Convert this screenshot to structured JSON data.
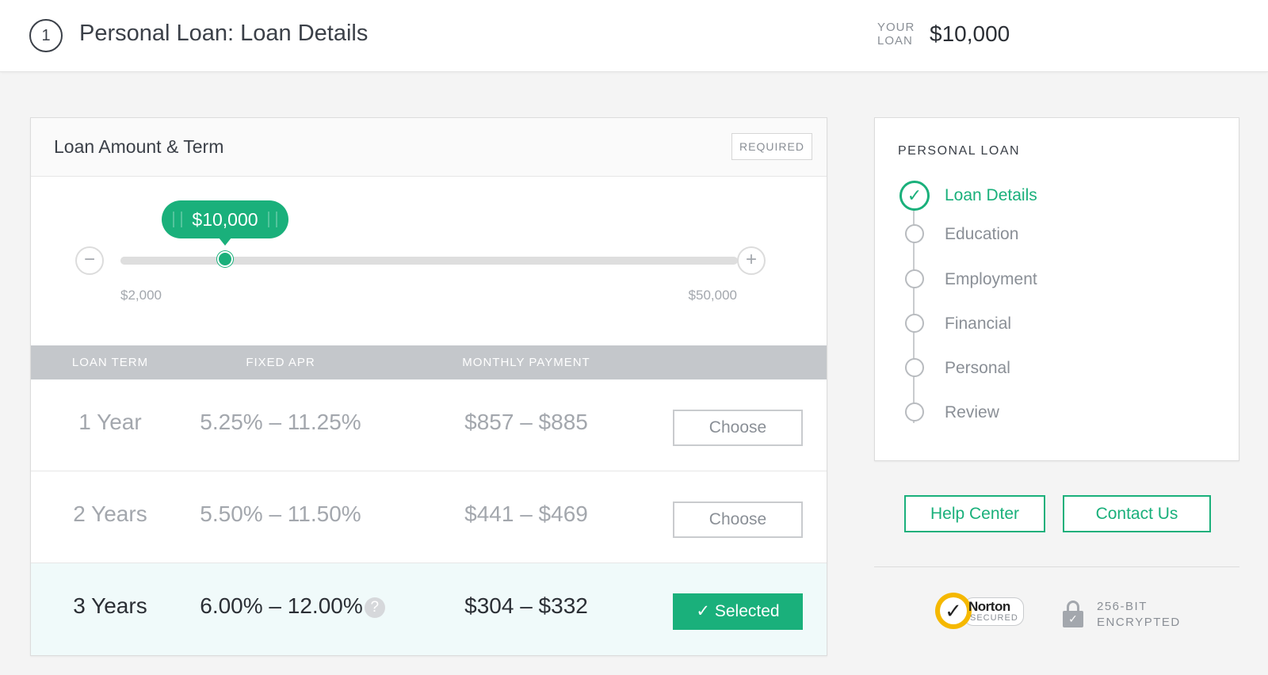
{
  "header": {
    "step_number": "1",
    "title": "Personal Loan: Loan Details",
    "your_loan_label_line1": "YOUR",
    "your_loan_label_line2": "LOAN",
    "your_loan_value": "$10,000"
  },
  "loan_card": {
    "title": "Loan Amount & Term",
    "required_label": "REQUIRED",
    "slider": {
      "value_label": "$10,000",
      "value": 10000,
      "min": 2000,
      "max": 50000,
      "min_label": "$2,000",
      "max_label": "$50,000",
      "minus_symbol": "−",
      "plus_symbol": "+"
    },
    "table": {
      "headers": [
        "LOAN TERM",
        "FIXED APR",
        "MONTHLY PAYMENT"
      ],
      "rows": [
        {
          "term": "1 Year",
          "apr": "5.25% – 11.25%",
          "payment": "$857 – $885",
          "action": "Choose",
          "selected": false
        },
        {
          "term": "2 Years",
          "apr": "5.50% – 11.50%",
          "payment": "$441 – $469",
          "action": "Choose",
          "selected": false
        },
        {
          "term": "3 Years",
          "apr": "6.00% – 12.00%",
          "payment": "$304 – $332",
          "action": "Selected",
          "selected": true,
          "help_symbol": "?"
        }
      ]
    }
  },
  "sidebar": {
    "title": "PERSONAL LOAN",
    "steps": [
      {
        "label": "Loan Details",
        "status": "complete"
      },
      {
        "label": "Education",
        "status": "pending"
      },
      {
        "label": "Employment",
        "status": "pending"
      },
      {
        "label": "Financial",
        "status": "pending"
      },
      {
        "label": "Personal",
        "status": "pending"
      },
      {
        "label": "Review",
        "status": "pending"
      }
    ],
    "check_symbol": "✓",
    "help_center_label": "Help Center",
    "contact_us_label": "Contact Us"
  },
  "trust": {
    "norton_name": "Norton",
    "norton_secured": "SECURED",
    "norton_mark": "✓",
    "encryption_line1": "256-BIT",
    "encryption_line2": "ENCRYPTED",
    "lock_mark": "✓"
  },
  "colors": {
    "accent": "#1ab07b",
    "background": "#f4f4f4",
    "table_header": "#c4c7cb",
    "selected_row": "#f0fafa"
  }
}
